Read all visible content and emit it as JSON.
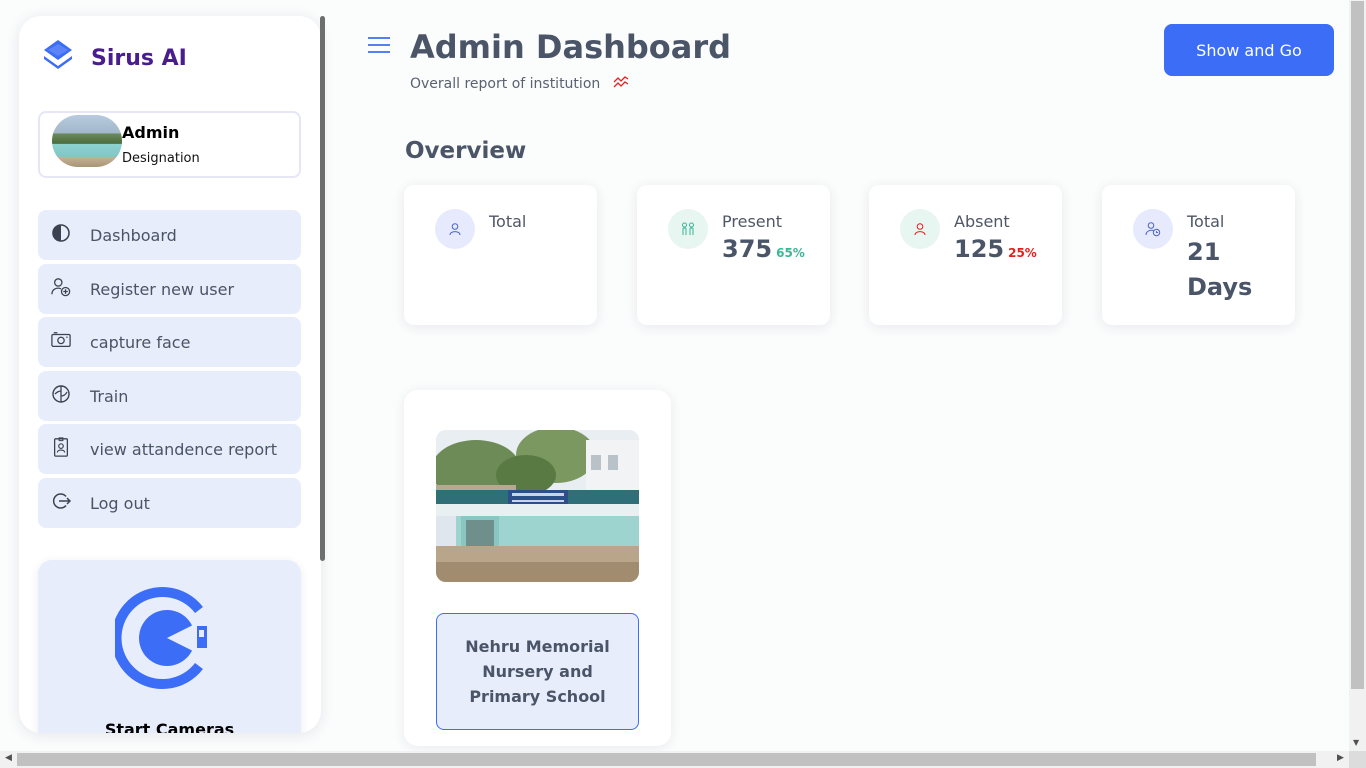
{
  "brand": {
    "name": "Sirus AI"
  },
  "profile": {
    "name": "Admin",
    "designation": "Designation"
  },
  "nav": {
    "items": [
      {
        "label": "Dashboard",
        "icon": "half-circle-icon"
      },
      {
        "label": "Register new user",
        "icon": "user-add-icon"
      },
      {
        "label": "capture face",
        "icon": "camera-icon"
      },
      {
        "label": "Train",
        "icon": "brain-icon"
      },
      {
        "label": "view attandence report",
        "icon": "id-badge-icon"
      },
      {
        "label": "Log out",
        "icon": "logout-icon"
      }
    ]
  },
  "camera": {
    "label": "Start Cameras"
  },
  "header": {
    "title": "Admin Dashboard",
    "subtitle": "Overall report of institution",
    "action_label": "Show and Go"
  },
  "overview": {
    "title": "Overview",
    "cards": [
      {
        "label": "Total",
        "value": "",
        "percent": "",
        "icon": "user-icon",
        "accent": "#4a64c8",
        "icon_bg": "#e6eafc"
      },
      {
        "label": "Present",
        "value": "375",
        "percent": "65%",
        "icon": "people-icon",
        "accent": "#3ab795",
        "icon_bg": "#e8f6f1"
      },
      {
        "label": "Absent",
        "value": "125",
        "percent": "25%",
        "icon": "user-icon",
        "accent": "#e51f1f",
        "icon_bg": "#e8f6f1"
      },
      {
        "label": "Total",
        "value": "21 Days",
        "percent": "",
        "icon": "user-clock-icon",
        "accent": "#4a64c8",
        "icon_bg": "#e6eafc"
      }
    ]
  },
  "school": {
    "name": "Nehru Memorial Nursery and Primary School"
  },
  "colors": {
    "accent": "#3c6df6",
    "brand": "#4a1d8f",
    "present": "#3ab795",
    "absent": "#e51f1f"
  }
}
